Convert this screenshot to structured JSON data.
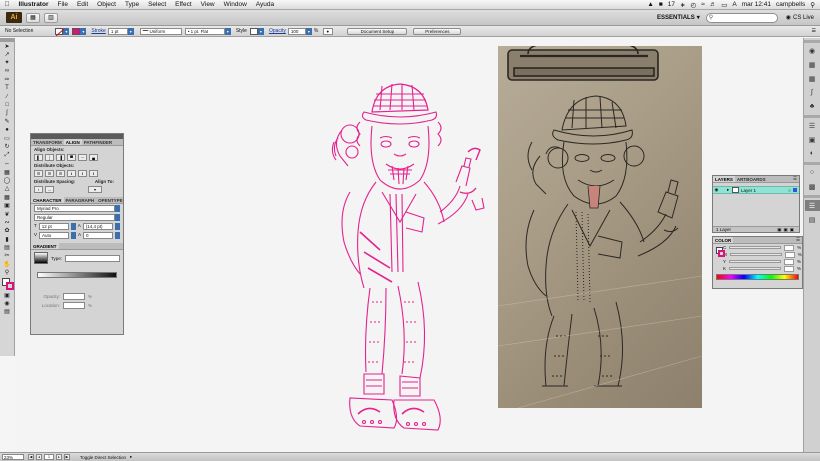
{
  "menubar": {
    "app_name": "Illustrator",
    "items": [
      "File",
      "Edit",
      "Object",
      "Type",
      "Select",
      "Effect",
      "View",
      "Window",
      "Ayuda"
    ],
    "status": {
      "counter": "17",
      "flag": "A",
      "time": "mar 12:41",
      "user": "campbells"
    }
  },
  "appbar": {
    "logo": "Ai",
    "workspace": "ESSENTIALS",
    "search_placeholder": "",
    "cs_live": "CS Live"
  },
  "controlbar": {
    "selection": "No Selection",
    "stroke_label": "Stroke",
    "stroke_weight": "1 pt",
    "profile": "Uniform",
    "brush": "1 pt. Flat",
    "style_label": "Style",
    "opacity_label": "Opacity",
    "opacity_value": "100",
    "opacity_unit": "%",
    "document_setup": "Document Setup",
    "preferences": "Preferences",
    "colors": {
      "fill": "#ffffff",
      "stroke": "#d6137f"
    }
  },
  "align_panel": {
    "tabs": [
      "TRANSFORM",
      "ALIGN",
      "PATHFINDER"
    ],
    "align_objects": "Align Objects:",
    "distribute_objects": "Distribute Objects:",
    "distribute_spacing": "Distribute Spacing:",
    "align_to": "Align To:"
  },
  "character_panel": {
    "tabs": [
      "CHARACTER",
      "PARAGRAPH",
      "OPENTYPE"
    ],
    "font": "Myriad Pro",
    "style": "Regular",
    "size": "12 pt",
    "leading": "(14,4 pt)",
    "kerning": "Auto",
    "tracking": "0"
  },
  "gradient_panel": {
    "tab": "GRADIENT",
    "type_label": "Type:",
    "opacity_label": "Opacity:",
    "location_label": "Location:",
    "pct": "%"
  },
  "layers_panel": {
    "tabs": [
      "LAYERS",
      "ARTBOARDS"
    ],
    "layer_name": "Layer 1",
    "count": "1 Layer"
  },
  "color_panel": {
    "tab": "COLOR",
    "channels": [
      "C",
      "M",
      "Y",
      "K"
    ],
    "pct": "%"
  },
  "statusbar": {
    "zoom": "23%",
    "page": "1",
    "tool": "Toggle Direct Selection"
  },
  "colors": {
    "sketch_magenta": "#e3238f",
    "layer_highlight": "#8fe3d2",
    "accent_blue": "#3a6fb0"
  }
}
